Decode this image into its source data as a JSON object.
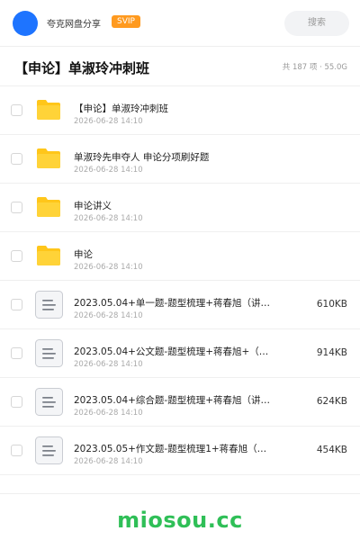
{
  "header": {
    "site_name": "夸克网盘分享",
    "badge": "SVIP",
    "search_placeholder": "搜索"
  },
  "title_row": {
    "title": "【申论】单淑玲冲刺班",
    "summary": "共 187 项 · 55.0G"
  },
  "files": [
    {
      "type": "folder",
      "name": "【申论】单淑玲冲刺班",
      "date": "2026-06-28 14:10",
      "size": ""
    },
    {
      "type": "folder",
      "name": "单淑玲先申夺人 申论分项刷好题",
      "date": "2026-06-28 14:10",
      "size": ""
    },
    {
      "type": "folder",
      "name": "申论讲义",
      "date": "2026-06-28 14:10",
      "size": ""
    },
    {
      "type": "folder",
      "name": "申论",
      "date": "2026-06-28 14:10",
      "size": ""
    },
    {
      "type": "doc",
      "name": "2023.05.04+单一题-题型梳理+蒋春旭（讲…",
      "date": "2026-06-28 14:10",
      "size": "610KB"
    },
    {
      "type": "doc",
      "name": "2023.05.04+公文题-题型梳理+蒋春旭+（…",
      "date": "2026-06-28 14:10",
      "size": "914KB"
    },
    {
      "type": "doc",
      "name": "2023.05.04+综合题-题型梳理+蒋春旭（讲…",
      "date": "2026-06-28 14:10",
      "size": "624KB"
    },
    {
      "type": "doc",
      "name": "2023.05.05+作文题-题型梳理1+蒋春旭（…",
      "date": "2026-06-28 14:10",
      "size": "454KB"
    }
  ],
  "footer": {
    "watermark": "miosou.cc"
  },
  "colors": {
    "avatar": "#1e74ff",
    "badge": "#ff9a1f",
    "folder": "#ffc61a",
    "watermark": "#2fbf57"
  },
  "icons": {
    "folder": "folder-icon",
    "doc": "document-icon",
    "checkbox": "checkbox-icon"
  }
}
